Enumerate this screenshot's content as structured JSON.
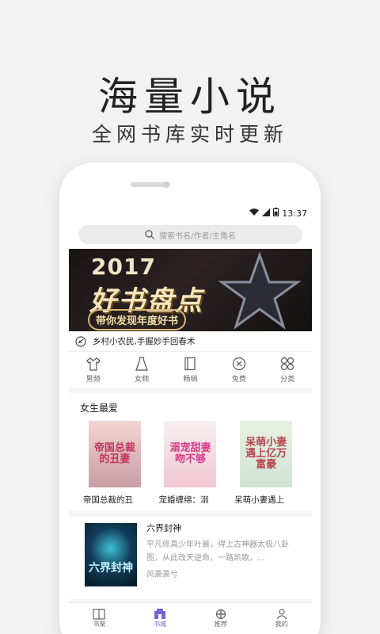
{
  "hero": {
    "title": "海量小说",
    "subtitle": "全网书库实时更新"
  },
  "status": {
    "time": "13:37"
  },
  "search": {
    "placeholder": "搜索书名/作者/主角名"
  },
  "banner": {
    "year": "2017",
    "headline": "好书盘点",
    "tagline": "带你发现年度好书"
  },
  "notice": {
    "text": "乡村小农民,手握妙手回春术"
  },
  "categories": [
    {
      "label": "男频",
      "icon": "male-shirt-icon"
    },
    {
      "label": "女频",
      "icon": "female-dress-icon"
    },
    {
      "label": "畅销",
      "icon": "book-icon"
    },
    {
      "label": "免费",
      "icon": "free-tag-icon"
    },
    {
      "label": "分类",
      "icon": "grid-icon"
    }
  ],
  "section": {
    "title": "女生最爱",
    "books": [
      {
        "title": "帝国总裁的丑",
        "cover_text": "帝国总裁的丑妻"
      },
      {
        "title": "宠婚缠绵：溺",
        "cover_text": "溺宠甜妻吻不够"
      },
      {
        "title": "呆萌小妻遇上",
        "cover_text": "呆萌小妻遇上亿万富豪"
      }
    ]
  },
  "featured": {
    "title": "六界封神",
    "description": "平凡修真少年叶晨，得上古神器太极八卦图，从此改天逆命，一路凯歌，...",
    "author": "风萧萧兮",
    "cover_text": "六界封神"
  },
  "tabs": [
    {
      "label": "书架",
      "icon": "bookshelf-icon",
      "active": false
    },
    {
      "label": "书城",
      "icon": "bookstore-icon",
      "active": true
    },
    {
      "label": "推荐",
      "icon": "recommend-icon",
      "active": false
    },
    {
      "label": "我的",
      "icon": "profile-icon",
      "active": false
    }
  ],
  "colors": {
    "accent": "#7a63d6",
    "banner_gold": "#f5e6bf"
  }
}
